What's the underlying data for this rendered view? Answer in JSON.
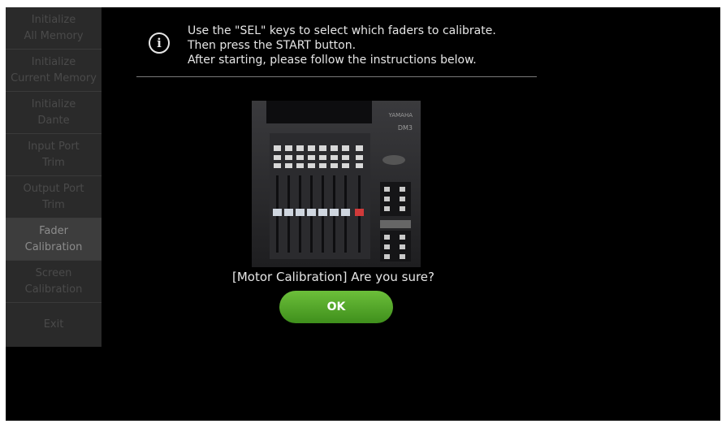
{
  "sidebar": {
    "items": [
      {
        "label": "Initialize\nAll Memory",
        "active": false
      },
      {
        "label": "Initialize\nCurrent Memory",
        "active": false
      },
      {
        "label": "Initialize\nDante",
        "active": false
      },
      {
        "label": "Input Port\nTrim",
        "active": false
      },
      {
        "label": "Output Port\nTrim",
        "active": false
      },
      {
        "label": "Fader\nCalibration",
        "active": true
      },
      {
        "label": "Screen\nCalibration",
        "active": false
      },
      {
        "label": "Exit",
        "active": false
      }
    ]
  },
  "main": {
    "info_icon": "info-icon",
    "message_line1": "Use the \"SEL\" keys to select which faders to calibrate.",
    "message_line2": "Then press the START button.",
    "message_line3": "After starting, please follow the instructions below.",
    "console_image": {
      "brand": "YAMAHA",
      "model": "DM3"
    },
    "question": "[Motor Calibration] Are you sure?",
    "ok_label": "OK"
  }
}
